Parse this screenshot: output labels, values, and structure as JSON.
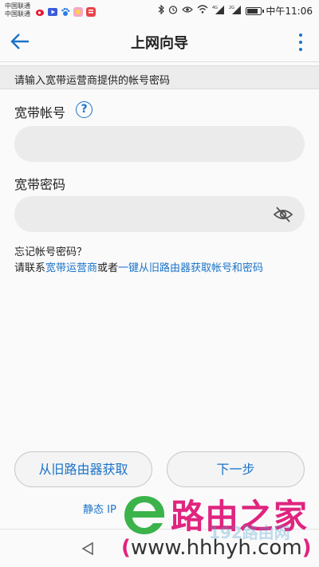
{
  "status_bar": {
    "carrier_1": "中国联通",
    "carrier_2": "中国联通",
    "signal_1_label": "4G",
    "signal_2_label": "2G",
    "time": "中午11:06",
    "battery_level": 0.85,
    "icons": [
      "weibo-icon",
      "video-icon",
      "paw-icon",
      "app-icon",
      "news-icon",
      "bluetooth-icon",
      "alarm-icon",
      "eye-icon",
      "wifi-icon",
      "signal-icon",
      "signal-icon",
      "battery-icon"
    ]
  },
  "header": {
    "title": "上网向导"
  },
  "hint": {
    "text": "请输入宽带运营商提供的帐号密码"
  },
  "form": {
    "account_label": "宽带帐号",
    "account_value": "",
    "password_label": "宽带密码",
    "password_value": "",
    "help_glyph": "?"
  },
  "forgot": {
    "title": "忘记帐号密码？",
    "prefix": "请联系",
    "isp_link": "宽带运营商",
    "middle": "或者",
    "router_link": "一键从旧路由器获取帐号和密码"
  },
  "buttons": {
    "fetch_old_router": "从旧路由器获取",
    "next": "下一步"
  },
  "footer": {
    "static_ip": "静态 IP"
  },
  "watermark": {
    "brand": "路由之家",
    "url_open": "(",
    "url": "www.hhhyh.com",
    "url_close": ")",
    "faint_text": "192路由网"
  },
  "colors": {
    "accent": "#1a73c9",
    "watermark_pink": "#e0247f",
    "watermark_green": "#3bb34a",
    "field_bg": "#ebebeb"
  }
}
